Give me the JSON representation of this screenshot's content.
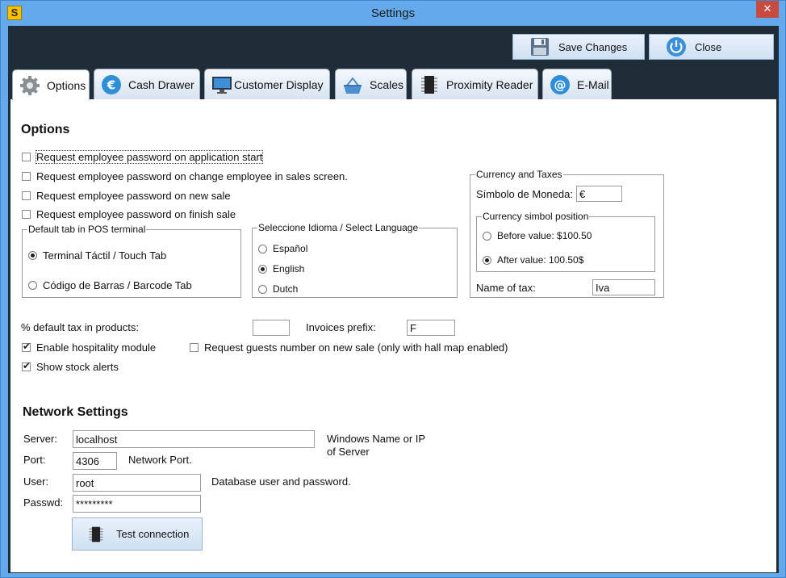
{
  "window": {
    "title": "Settings",
    "icon_letter": "S",
    "close_glyph": "✕"
  },
  "toolbar": {
    "save_label": "Save Changes",
    "close_label": "Close"
  },
  "tabs": [
    {
      "label": "Options",
      "icon": "gear-icon"
    },
    {
      "label": "Cash Drawer",
      "icon": "euro-icon"
    },
    {
      "label": "Customer Display",
      "icon": "monitor-icon"
    },
    {
      "label": "Scales",
      "icon": "scale-icon"
    },
    {
      "label": "Proximity Reader",
      "icon": "chip-icon"
    },
    {
      "label": "E-Mail",
      "icon": "at-icon"
    }
  ],
  "options": {
    "heading": "Options",
    "checks": [
      {
        "label": "Request employee password on application start",
        "checked": false
      },
      {
        "label": "Request employee password on change employee in sales screen.",
        "checked": false
      },
      {
        "label": "Request employee password on new sale",
        "checked": false
      },
      {
        "label": "Request employee password on finish sale",
        "checked": false
      }
    ],
    "default_tab": {
      "legend": "Default tab in POS terminal",
      "options": [
        "Terminal Táctil / Touch Tab",
        "Código de Barras / Barcode Tab"
      ],
      "selected": 0
    },
    "language": {
      "legend": "Seleccione Idioma / Select Language",
      "options": [
        "Español",
        "English",
        "Dutch"
      ],
      "selected": 1
    },
    "currency": {
      "legend": "Currency and Taxes",
      "symbol_label": "Símbolo de Moneda:",
      "symbol_value": "€",
      "position_legend": "Currency simbol position",
      "position_options": [
        "Before value: $100.50",
        "After value: 100.50$"
      ],
      "position_selected": 1,
      "tax_label": "Name of tax:",
      "tax_value": "Iva"
    },
    "default_tax_label": "% default tax in products:",
    "default_tax_value": "",
    "invoices_prefix_label": "Invoices prefix:",
    "invoices_prefix_value": "F",
    "hospitality_label": "Enable hospitality module",
    "hospitality_checked": true,
    "guests_label": "Request guests number on new sale (only with hall map enabled)",
    "guests_checked": false,
    "stock_label": "Show stock alerts",
    "stock_checked": true
  },
  "network": {
    "heading": "Network Settings",
    "server_label": "Server:",
    "server_value": "localhost",
    "server_hint": "Windows Name or IP of Server",
    "port_label": "Port:",
    "port_value": "4306",
    "port_hint": "Network Port.",
    "user_label": "User:",
    "user_value": "root",
    "user_hint": "Database user and password.",
    "pass_label": "Passwd:",
    "pass_value": "*********",
    "test_label": "Test connection"
  }
}
